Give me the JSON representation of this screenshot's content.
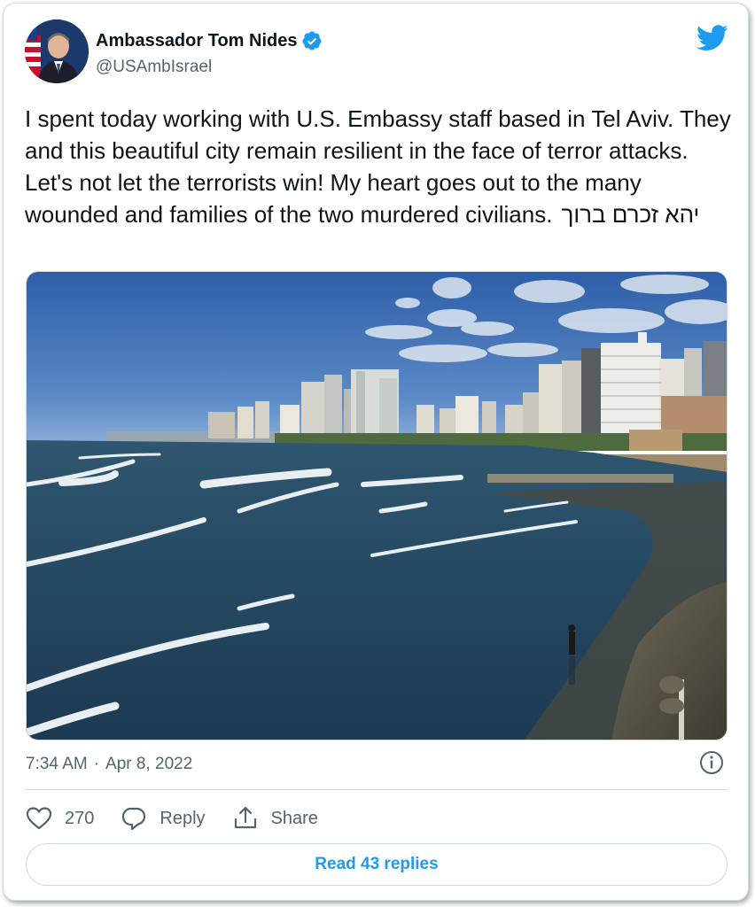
{
  "author": {
    "display_name": "Ambassador Tom Nides",
    "handle": "@USAmbIsrael",
    "verified": true,
    "avatar_icon": "profile-avatar"
  },
  "brand": {
    "icon": "twitter-bird-icon",
    "color": "#1d9bf0"
  },
  "tweet": {
    "text": "I spent today working with U.S. Embassy staff based in Tel Aviv. They and this beautiful city remain resilient in the face of terror attacks. Let's not let the terrorists win! My heart goes out to the many wounded and families of the two murdered civilians.",
    "hebrew_text": "יהא זכרם ברוך"
  },
  "media": {
    "icon": "photo-tel-aviv-beach"
  },
  "meta": {
    "time": "7:34 AM",
    "separator": "·",
    "date": "Apr 8, 2022"
  },
  "actions": {
    "like_count": "270",
    "reply_label": "Reply",
    "share_label": "Share"
  },
  "read_replies_label": "Read 43 replies",
  "colors": {
    "text": "#0f1419",
    "secondary": "#536471",
    "accent": "#1d9bf0",
    "border": "#cfd9de"
  }
}
